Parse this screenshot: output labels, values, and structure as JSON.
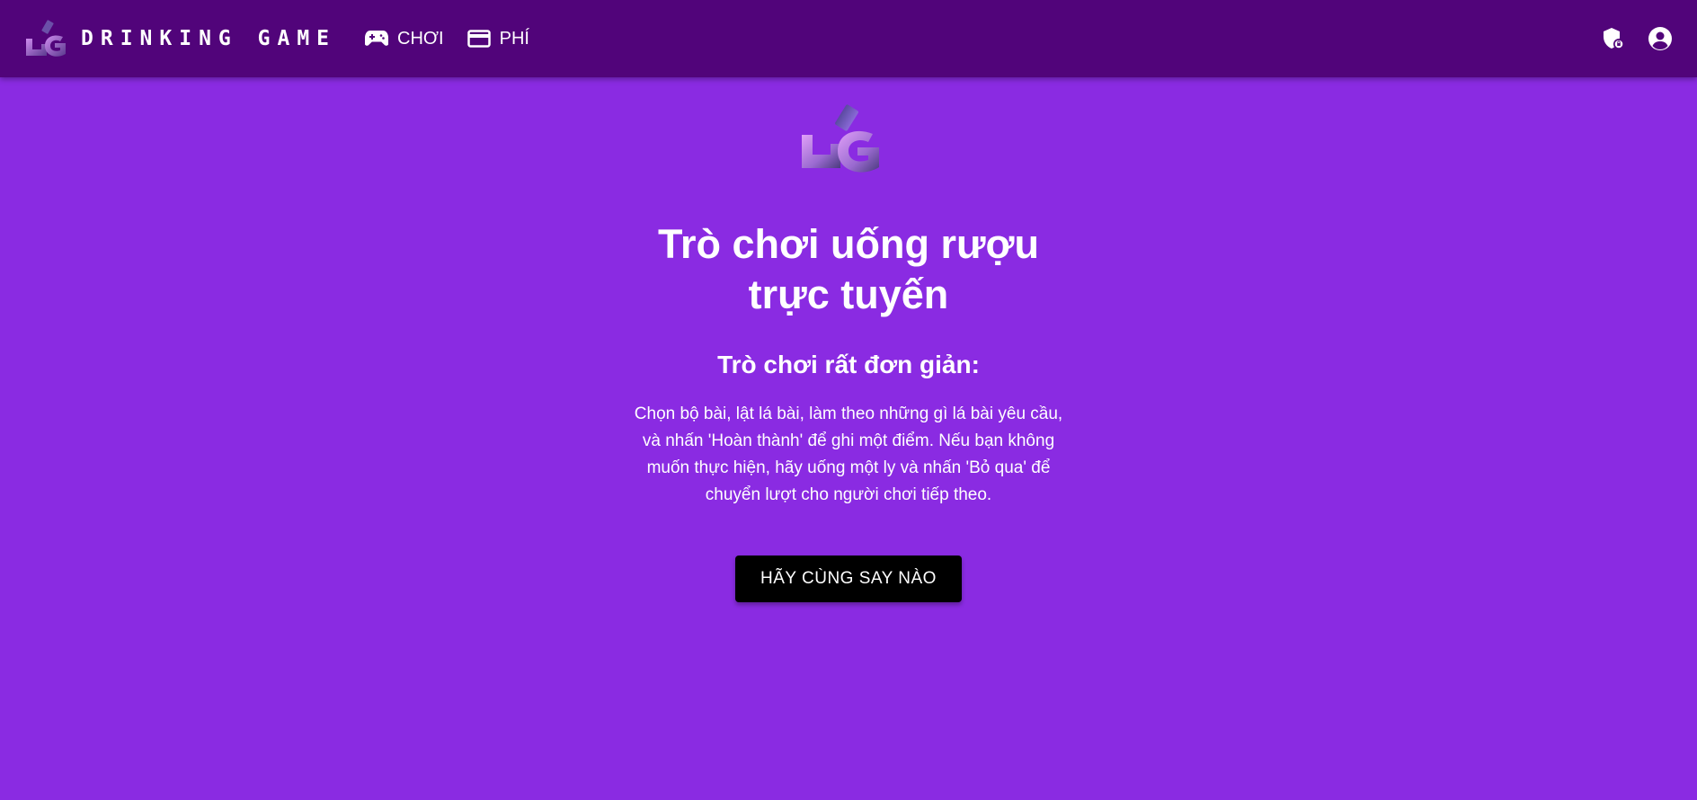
{
  "header": {
    "brand": "DRINKING GAME",
    "nav": [
      {
        "label": "CHƠI",
        "icon": "gamepad-icon"
      },
      {
        "label": "PHÍ",
        "icon": "credit-card-icon"
      }
    ],
    "icons": [
      "privacy-shield-icon",
      "account-circle-icon"
    ]
  },
  "hero": {
    "title": "Trò chơi uống rượu trực tuyến",
    "subtitle": "Trò chơi rất đơn giản:",
    "description": "Chọn bộ bài, lật lá bài, làm theo những gì lá bài yêu cầu, và nhấn 'Hoàn thành' để ghi một điểm. Nếu bạn không muốn thực hiện, hãy uống một ly và nhấn 'Bỏ qua' để chuyển lượt cho người chơi tiếp theo.",
    "cta_label": "HÃY CÙNG SAY NÀO"
  },
  "colors": {
    "background": "#8a2be2",
    "appbar": "#51047a",
    "button": "#000000",
    "text": "#ffffff"
  }
}
